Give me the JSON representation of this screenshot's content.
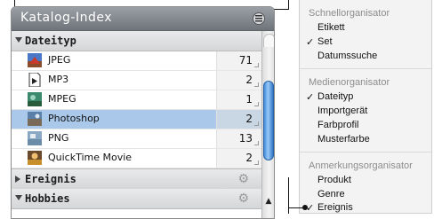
{
  "panel": {
    "title": "Katalog-Index",
    "groups": {
      "dateityp": "Dateityp",
      "ereignis": "Ereignis",
      "cut": "Hobbies"
    },
    "items": [
      {
        "name": "JPEG",
        "count": "71"
      },
      {
        "name": "MP3",
        "count": "2"
      },
      {
        "name": "MPEG",
        "count": "1"
      },
      {
        "name": "Photoshop",
        "count": "2"
      },
      {
        "name": "PNG",
        "count": "13"
      },
      {
        "name": "QuickTime Movie",
        "count": "2"
      }
    ]
  },
  "menu": {
    "schnell_header": "Schnellorganisator",
    "schnell_items": [
      "Etikett",
      "Set",
      "Datumssuche"
    ],
    "medien_header": "Medienorganisator",
    "medien_items": [
      "Dateityp",
      "Importgerät",
      "Farbprofil",
      "Musterfarbe"
    ],
    "anmerk_header": "Anmerkungsorganisator",
    "anmerk_items": [
      "Produkt",
      "Genre",
      "Ereignis"
    ],
    "checkmark": "✓"
  }
}
